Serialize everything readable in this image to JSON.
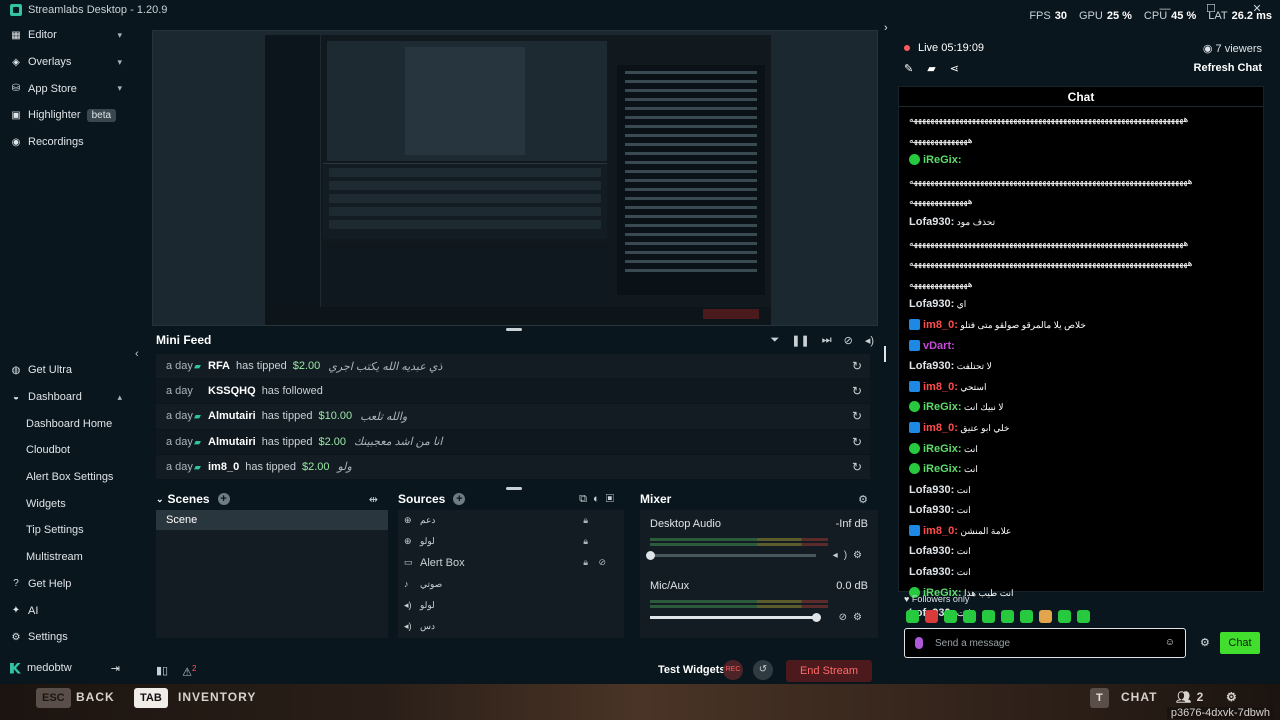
{
  "window": {
    "title": "Streamlabs Desktop - 1.20.9",
    "controls": [
      "—",
      "☐",
      "✕"
    ]
  },
  "stats": {
    "fps_label": "FPS",
    "fps": "30",
    "gpu_label": "GPU",
    "gpu": "25",
    "cpu_label": "CPU",
    "cpu": "45",
    "lat_label": "LAT",
    "lat": "26.2",
    "pct_unit": "%",
    "ms_unit": "ms"
  },
  "sidebar": {
    "top": [
      {
        "label": "Editor",
        "icon": "editor-icon"
      },
      {
        "label": "Overlays",
        "icon": "overlays-icon"
      },
      {
        "label": "App Store",
        "icon": "app-store-icon"
      },
      {
        "label": "Highlighter",
        "badge": "beta",
        "icon": "highlighter-icon"
      },
      {
        "label": "Recordings",
        "icon": "recordings-icon"
      }
    ],
    "get_ultra": "Get Ultra",
    "dashboard": "Dashboard",
    "dashboard_items": [
      "Dashboard Home",
      "Cloudbot",
      "Alert Box Settings",
      "Widgets",
      "Tip Settings",
      "Multistream"
    ],
    "get_help": "Get Help",
    "ai": "AI",
    "settings": "Settings",
    "username": "medobtw"
  },
  "mini_feed": {
    "title": "Mini Feed",
    "rows": [
      {
        "when": "a day",
        "who": "RFA",
        "action": "has tipped",
        "amount": "$2.00",
        "message": "ذي عبديه الله يكتب اجري"
      },
      {
        "when": "a day",
        "who": "KSSQHQ",
        "action": "has followed",
        "amount": "",
        "message": ""
      },
      {
        "when": "a day",
        "who": "Almutairi",
        "action": "has tipped",
        "amount": "$10.00",
        "message": "والله تلعب"
      },
      {
        "when": "a day",
        "who": "Almutairi",
        "action": "has tipped",
        "amount": "$2.00",
        "message": "انا من اشد معجبينك"
      },
      {
        "when": "a day",
        "who": "im8_0",
        "action": "has tipped",
        "amount": "$2.00",
        "message": "ولو"
      }
    ]
  },
  "scenes": {
    "title": "Scenes",
    "items": [
      "Scene"
    ]
  },
  "sources": {
    "title": "Sources",
    "items": [
      {
        "label": "دعم",
        "icon": "globe-icon"
      },
      {
        "label": "لولو",
        "icon": "globe-icon"
      },
      {
        "label": "Alert Box",
        "icon": "alert-box-icon"
      },
      {
        "label": "صوتي",
        "icon": "mic-icon"
      },
      {
        "label": "لولو",
        "icon": "speaker-icon"
      },
      {
        "label": "دس",
        "icon": "speaker-icon"
      }
    ]
  },
  "mixer": {
    "title": "Mixer",
    "channels": [
      {
        "name": "Desktop Audio",
        "db": "-Inf dB",
        "level": 0
      },
      {
        "name": "Mic/Aux",
        "db": "0.0 dB",
        "level": 1
      }
    ]
  },
  "bottombar": {
    "test_widgets": "Test Widgets",
    "end_stream": "End Stream",
    "rec_label": "REC",
    "alert_count": "2"
  },
  "chat_panel": {
    "live": "Live 05:19:09",
    "viewers": "7 viewers",
    "refresh": "Refresh Chat",
    "chat_title": "Chat",
    "lines": [
      {
        "badge": "",
        "name": "",
        "color": "#ffffff",
        "text": "ههههههههههههههههههههههههههههههههههههههههههههههههههههههههههههههههههه"
      },
      {
        "badge": "",
        "name": "",
        "color": "#ffffff",
        "text": "ههههههههههههههه"
      },
      {
        "badge": "bg",
        "name": "iReGix:",
        "color": "#5ddc6b",
        "text": ""
      },
      {
        "badge": "",
        "name": "",
        "color": "#ffffff",
        "text": "هههههههههههههههههههههههههههههههههههههههههههههههههههههههههههههههههههه"
      },
      {
        "badge": "",
        "name": "",
        "color": "#ffffff",
        "text": "ههههههههههههههه"
      },
      {
        "badge": "",
        "name": "Lofa930:",
        "color": "#dfe4e8",
        "text": "تحذف مود"
      },
      {
        "badge": "",
        "name": "",
        "color": "#ffffff",
        "text": "ههههههههههههههههههههههههههههههههههههههههههههههههههههههههههههههههههه"
      },
      {
        "badge": "",
        "name": "",
        "color": "#ffffff",
        "text": "هههههههههههههههههههههههههههههههههههههههههههههههههههههههههههههههههههه"
      },
      {
        "badge": "",
        "name": "",
        "color": "#ffffff",
        "text": "ههههههههههههههه"
      },
      {
        "badge": "",
        "name": "Lofa930:",
        "color": "#dfe4e8",
        "text": "اي"
      },
      {
        "badge": "bb",
        "name": "im8_0:",
        "color": "#ff4d4d",
        "text": "خلاص يلا مالمرقو صولقو متى فتلو"
      },
      {
        "badge": "bb",
        "name": "vDart:",
        "color": "#c74ad9",
        "text": ""
      },
      {
        "badge": "",
        "name": "Lofa930:",
        "color": "#dfe4e8",
        "text": "لا تحتلفت"
      },
      {
        "badge": "bb",
        "name": "im8_0:",
        "color": "#ff4d4d",
        "text": "استحي"
      },
      {
        "badge": "bg",
        "name": "iReGix:",
        "color": "#5ddc6b",
        "text": "لا نبيك انت"
      },
      {
        "badge": "bb",
        "name": "im8_0:",
        "color": "#ff4d4d",
        "text": "خلي ابو عتيق"
      },
      {
        "badge": "bg",
        "name": "iReGix:",
        "color": "#5ddc6b",
        "text": "انت"
      },
      {
        "badge": "bg",
        "name": "iReGix:",
        "color": "#5ddc6b",
        "text": "انت"
      },
      {
        "badge": "",
        "name": "Lofa930:",
        "color": "#dfe4e8",
        "text": "انت"
      },
      {
        "badge": "",
        "name": "Lofa930:",
        "color": "#dfe4e8",
        "text": "انت"
      },
      {
        "badge": "bb",
        "name": "im8_0:",
        "color": "#ff4d4d",
        "text": "علامة المنشن"
      },
      {
        "badge": "",
        "name": "Lofa930:",
        "color": "#dfe4e8",
        "text": "انت"
      },
      {
        "badge": "",
        "name": "Lofa930:",
        "color": "#dfe4e8",
        "text": "انت"
      },
      {
        "badge": "bg",
        "name": "iReGix:",
        "color": "#5ddc6b",
        "text": "انت طيب هذا"
      },
      {
        "badge": "",
        "name": "Lofa930:",
        "color": "#dfe4e8",
        "text": "انت"
      }
    ],
    "followers_only": "Followers only",
    "input_placeholder": "Send a message",
    "chat_button": "Chat"
  },
  "game_overlay": {
    "esc_key": "ESC",
    "back": "BACK",
    "tab_key": "TAB",
    "inventory": "INVENTORY",
    "t_key": "T",
    "chat": "CHAT",
    "party_count": "2",
    "code": "p3676-4dxvk-7dbwh"
  }
}
